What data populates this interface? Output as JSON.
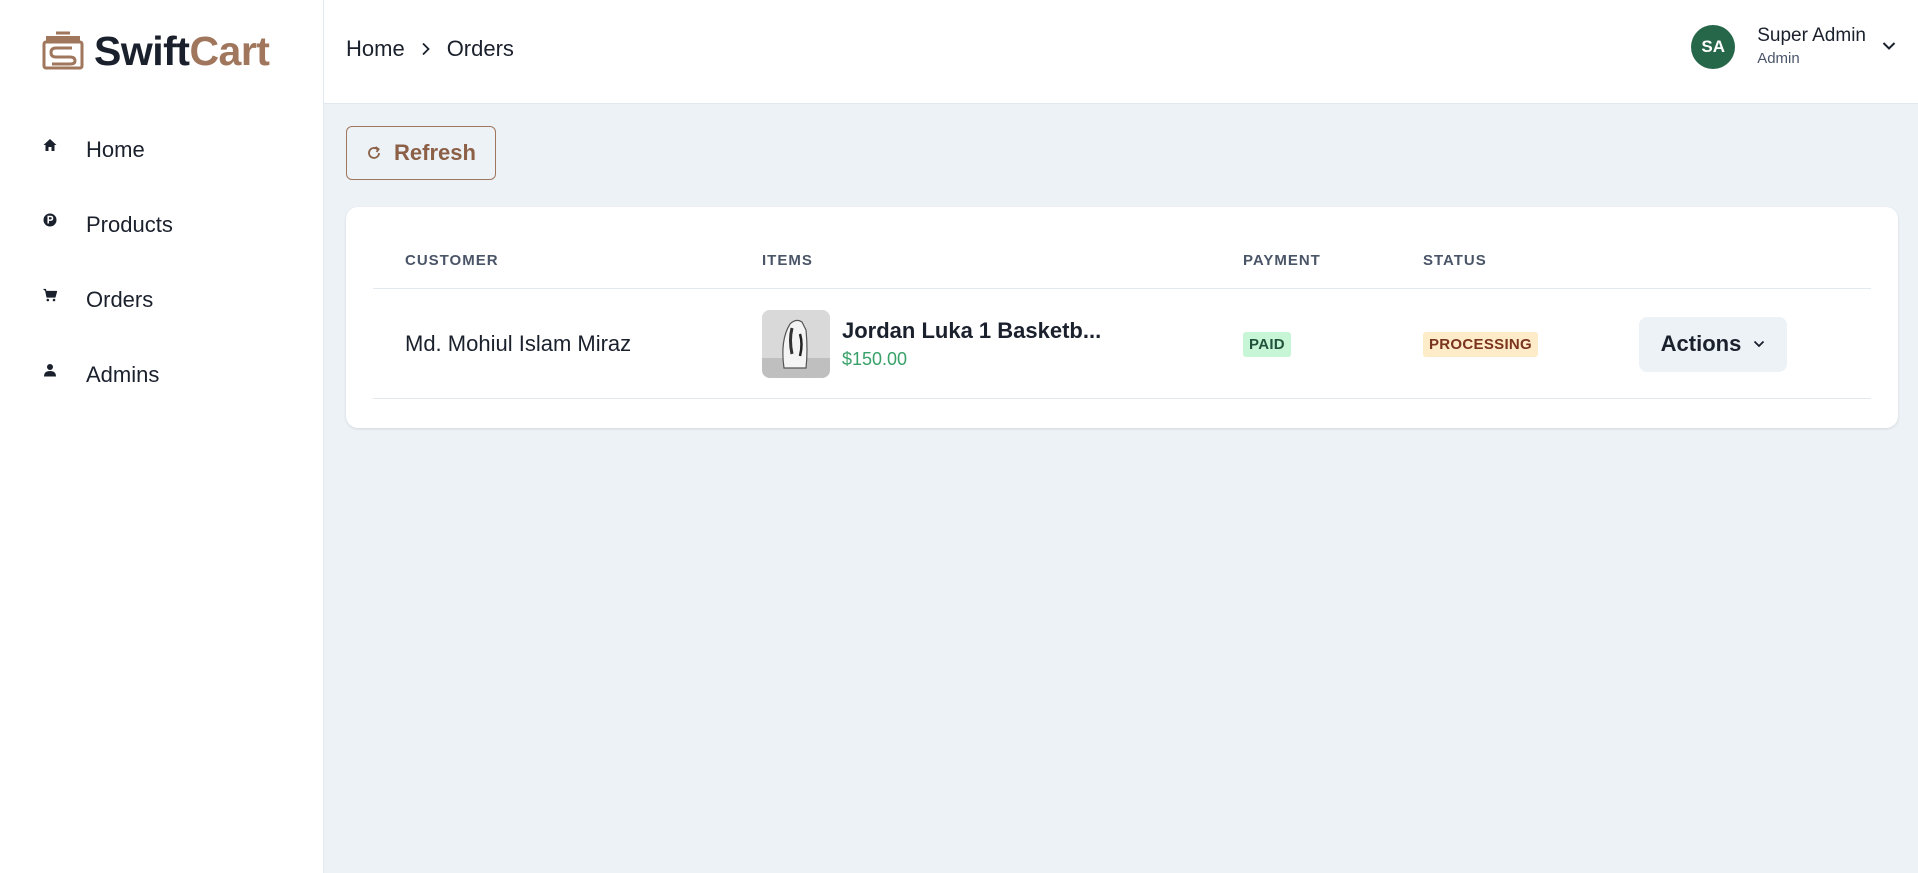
{
  "brand": {
    "part1": "Swift",
    "part2": "Cart",
    "accent_color": "#a0765c"
  },
  "sidebar": {
    "items": [
      {
        "label": "Home",
        "icon": "home-icon"
      },
      {
        "label": "Products",
        "icon": "product-icon"
      },
      {
        "label": "Orders",
        "icon": "cart-icon"
      },
      {
        "label": "Admins",
        "icon": "user-icon"
      }
    ]
  },
  "breadcrumb": {
    "items": [
      "Home",
      "Orders"
    ]
  },
  "user": {
    "initials": "SA",
    "name": "Super Admin",
    "role": "Admin",
    "avatar_color": "#276749"
  },
  "toolbar": {
    "refresh_label": "Refresh"
  },
  "table": {
    "headers": {
      "customer": "CUSTOMER",
      "items": "ITEMS",
      "payment": "PAYMENT",
      "status": "STATUS"
    },
    "rows": [
      {
        "customer": "Md. Mohiul Islam Miraz",
        "item_name": "Jordan Luka 1 Basketb...",
        "item_price": "$150.00",
        "payment": "PAID",
        "status": "PROCESSING",
        "actions_label": "Actions"
      }
    ]
  }
}
